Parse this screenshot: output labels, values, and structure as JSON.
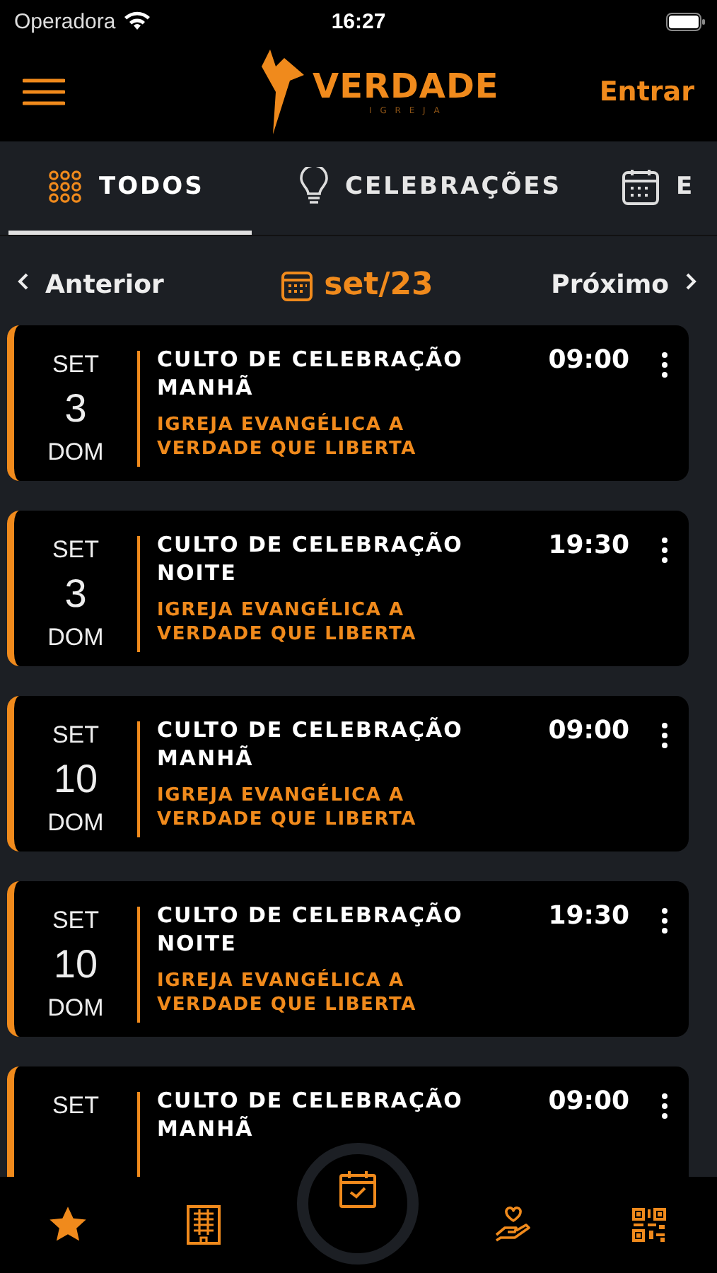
{
  "status_bar": {
    "carrier": "Operadora",
    "time": "16:27"
  },
  "header": {
    "logo": {
      "name": "VERDADE",
      "tagline": "I G R E J A"
    },
    "login": "Entrar"
  },
  "tabs": [
    {
      "label": "TODOS",
      "kind": "grid",
      "selected": true
    },
    {
      "label": "CELEBRAÇÕES",
      "kind": "bulb",
      "selected": false
    },
    {
      "label": "E",
      "kind": "calendar",
      "selected": false
    }
  ],
  "month_nav": {
    "previous": "Anterior",
    "current": "set/23",
    "next": "Próximo"
  },
  "events": [
    {
      "month": "SET",
      "day": "3",
      "weekday": "DOM",
      "title": "CULTO DE CELEBRAÇÃO MANHÃ",
      "place": "IGREJA EVANGÉLICA A VERDADE QUE LIBERTA",
      "time": "09:00"
    },
    {
      "month": "SET",
      "day": "3",
      "weekday": "DOM",
      "title": "CULTO DE CELEBRAÇÃO NOITE",
      "place": "IGREJA EVANGÉLICA A VERDADE QUE LIBERTA",
      "time": "19:30"
    },
    {
      "month": "SET",
      "day": "10",
      "weekday": "DOM",
      "title": "CULTO DE CELEBRAÇÃO MANHÃ",
      "place": "IGREJA EVANGÉLICA A VERDADE QUE LIBERTA",
      "time": "09:00"
    },
    {
      "month": "SET",
      "day": "10",
      "weekday": "DOM",
      "title": "CULTO DE CELEBRAÇÃO NOITE",
      "place": "IGREJA EVANGÉLICA A VERDADE QUE LIBERTA",
      "time": "19:30"
    },
    {
      "month": "SET",
      "title": "CULTO DE CELEBRAÇÃO MANHÃ",
      "time": "09:00"
    }
  ],
  "bottom_nav": [
    {
      "kind": "star",
      "selected": false
    },
    {
      "kind": "building",
      "selected": false
    },
    {
      "kind": "calendar",
      "selected": true
    },
    {
      "kind": "hands",
      "selected": false
    },
    {
      "kind": "qr",
      "selected": false
    }
  ]
}
